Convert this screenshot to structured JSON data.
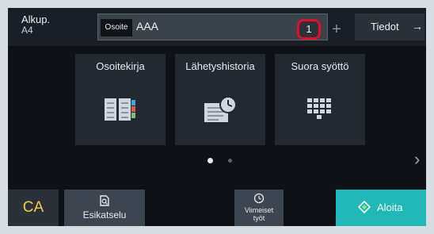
{
  "header": {
    "original_label": "Alkup.",
    "original_size": "A4",
    "address_label": "Osoite",
    "address_value": "AAA",
    "destination_count": "1",
    "plus_symbol": "+",
    "info_label": "Tiedot",
    "info_arrow": "→"
  },
  "tiles": [
    {
      "label": "Osoitekirja",
      "icon": "address-book-icon"
    },
    {
      "label": "Lähetyshistoria",
      "icon": "send-history-icon"
    },
    {
      "label": "Suora syöttö",
      "icon": "keypad-icon"
    }
  ],
  "pager": {
    "pages": 2,
    "current": 1,
    "next_symbol": "›"
  },
  "footer": {
    "ca_label": "CA",
    "preview_label": "Esikatselu",
    "recent_label_line1": "Viimeiset",
    "recent_label_line2": "työt",
    "start_label": "Aloita"
  },
  "colors": {
    "highlight": "#e0102b",
    "start_button": "#23b8b8",
    "ca_text": "#f2c94c",
    "book_accent": "#39a8d8",
    "dot_active": "#e6ebf0",
    "dot_inactive": "#5a626b"
  }
}
